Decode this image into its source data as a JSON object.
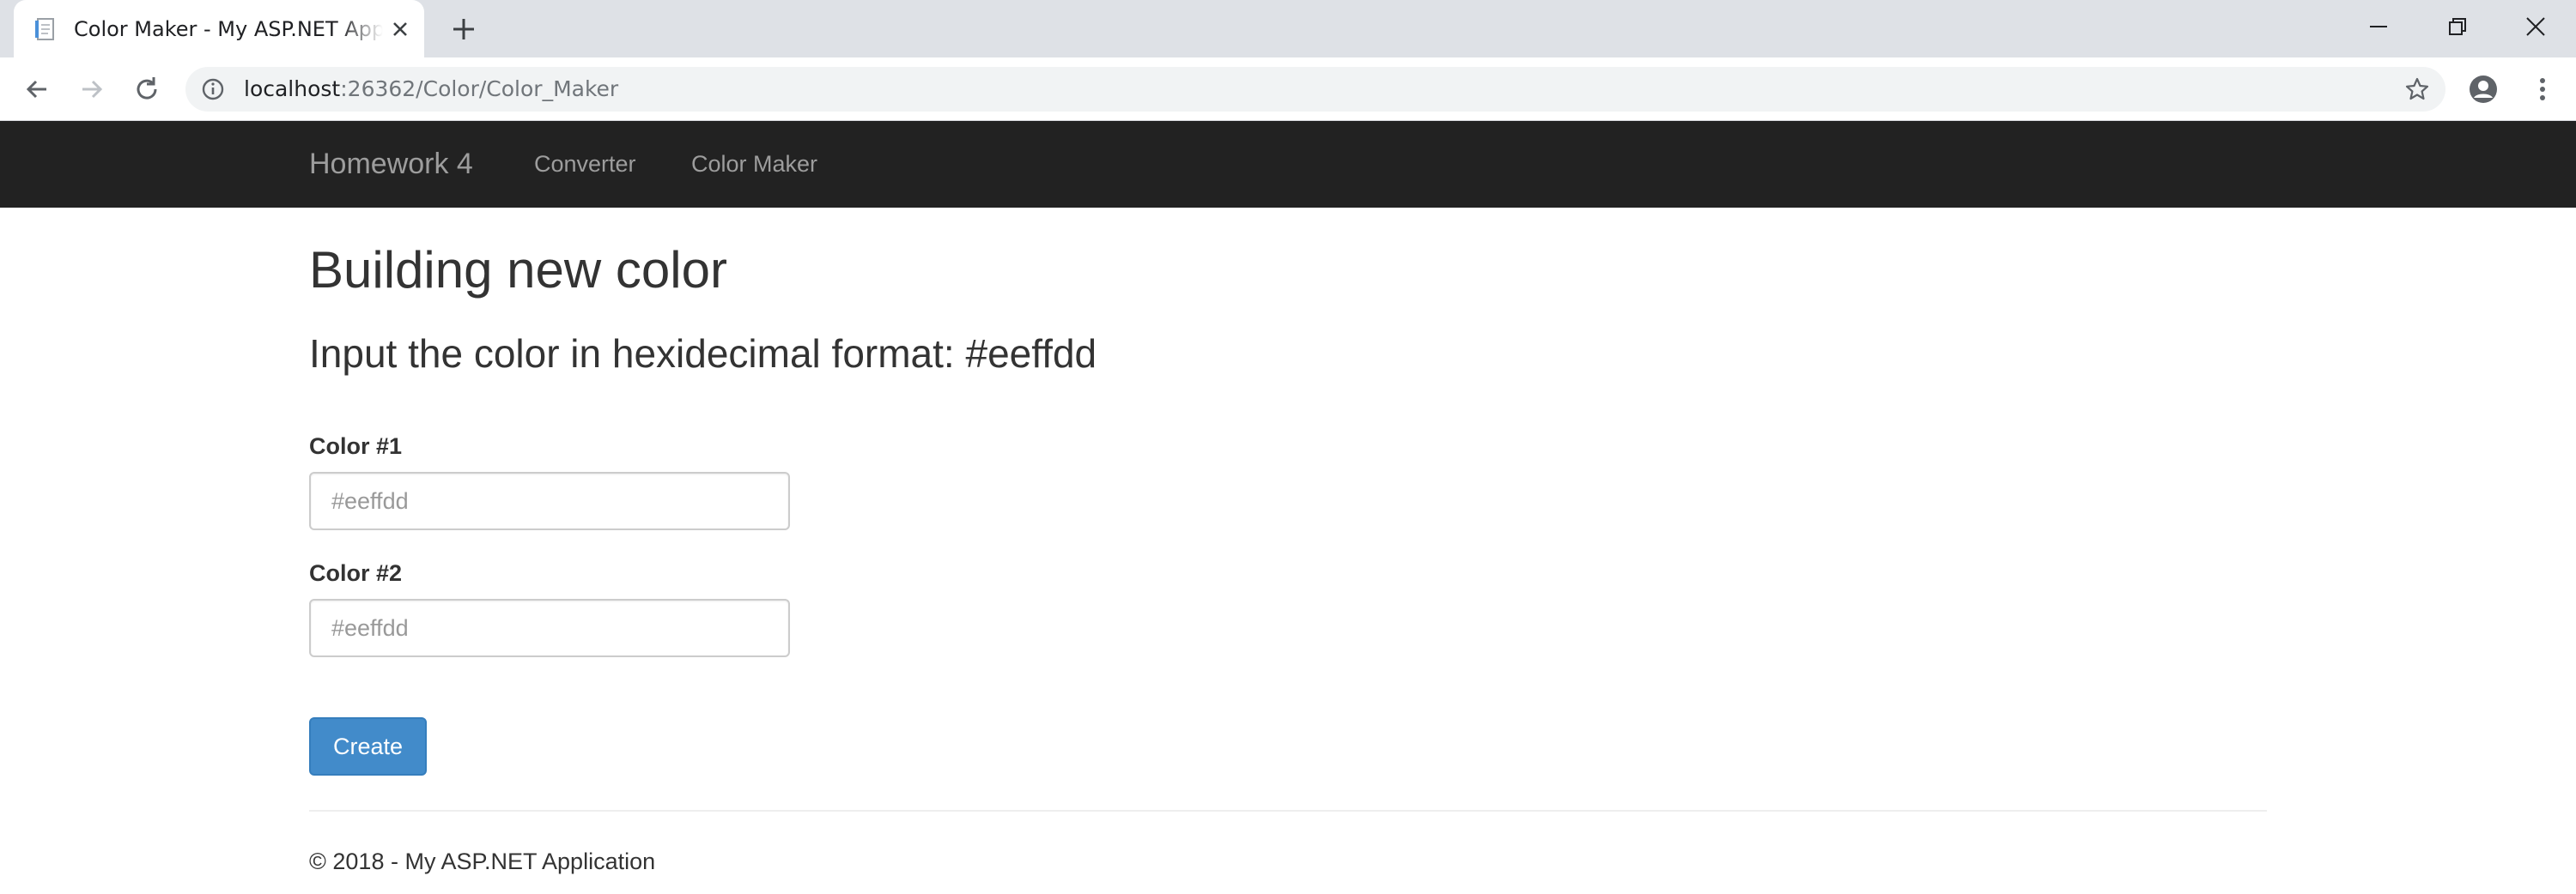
{
  "browser": {
    "tab_title": "Color Maker - My ASP.NET Application",
    "url_host": "localhost",
    "url_rest": ":26362/Color/Color_Maker"
  },
  "navbar": {
    "brand": "Homework 4",
    "links": [
      "Converter",
      "Color Maker"
    ]
  },
  "main": {
    "title": "Building new color",
    "subtitle": "Input the color in hexidecimal format: #eeffdd",
    "fields": [
      {
        "label": "Color #1",
        "placeholder": "#eeffdd",
        "value": ""
      },
      {
        "label": "Color #2",
        "placeholder": "#eeffdd",
        "value": ""
      }
    ],
    "submit_label": "Create"
  },
  "footer": {
    "text": "© 2018 - My ASP.NET Application"
  },
  "colors": {
    "navbar_bg": "#222222",
    "primary_button": "#428bca",
    "nav_text": "#9d9d9d"
  },
  "icons": [
    "page-icon",
    "close-icon",
    "plus-icon",
    "minimize-icon",
    "restore-icon",
    "window-close-icon",
    "back-arrow-icon",
    "forward-arrow-icon",
    "reload-icon",
    "info-icon",
    "star-icon",
    "account-icon",
    "kebab-menu-icon"
  ]
}
